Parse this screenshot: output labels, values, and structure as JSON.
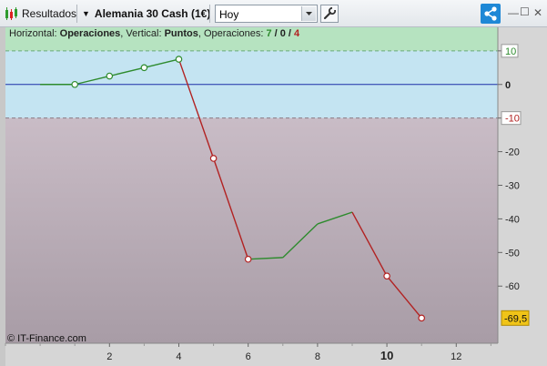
{
  "toolbar": {
    "results_label": "Resultados",
    "instrument_label": "Alemania 30 Cash (1€)",
    "period_value": "Hoy"
  },
  "chart_header": {
    "h_prefix": "Horizontal: ",
    "h_value": "Operaciones",
    "v_prefix": ", Vertical: ",
    "v_value": "Puntos",
    "ops_prefix": ", Operaciones: ",
    "ops_win": "7",
    "ops_slash1": " / ",
    "ops_neutral": "0",
    "ops_slash2": " / ",
    "ops_loss": "4"
  },
  "watermark": "© IT-Finance.com",
  "colors": {
    "win": "#2e8b2e",
    "loss": "#b22222",
    "zero_line": "#1c2fa8",
    "badge": "#f0c418"
  },
  "chart_data": {
    "type": "line",
    "x": [
      0,
      1,
      2,
      3,
      4,
      5,
      6,
      7,
      8,
      9,
      10,
      11
    ],
    "y": [
      0,
      0,
      2.5,
      5,
      7.5,
      -22,
      -52,
      -51.5,
      -41.5,
      -38,
      -57,
      -69.5
    ],
    "segment_colors": [
      "win",
      "win",
      "win",
      "win",
      "loss",
      "loss",
      "win",
      "win",
      "win",
      "loss",
      "loss"
    ],
    "marker_x": [
      1,
      2,
      3,
      4,
      5,
      6,
      10,
      11
    ],
    "xlim": [
      -1,
      13.2
    ],
    "ylim": [
      -77,
      17
    ],
    "x_ticks": [
      "2",
      "4",
      "6",
      "8",
      "10",
      "12"
    ],
    "x_tick_values": [
      2,
      4,
      6,
      8,
      10,
      12
    ],
    "bold_x_tick": "10",
    "y_ticks": [
      "10",
      "0",
      "-10",
      "-20",
      "-30",
      "-40",
      "-50",
      "-60"
    ],
    "y_tick_values": [
      10,
      0,
      -10,
      -20,
      -30,
      -40,
      -50,
      -60
    ],
    "upper_threshold": 10,
    "lower_threshold": -10,
    "last_value_label": "-69,5",
    "last_value": -69.5,
    "grid": false
  }
}
